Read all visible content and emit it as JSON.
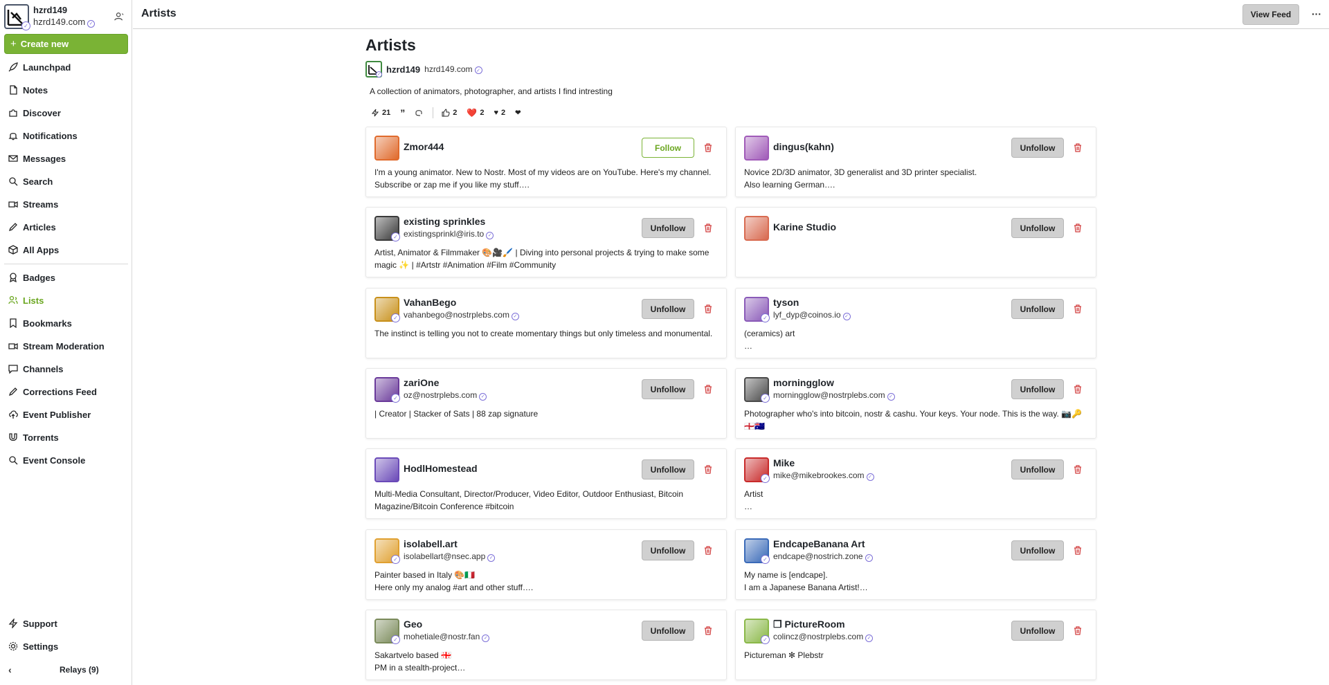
{
  "account": {
    "name": "hzrd149",
    "nip05": "hzrd149.com"
  },
  "sidebar": {
    "create_label": "Create new",
    "items": [
      {
        "label": "Launchpad",
        "icon": "rocket-icon"
      },
      {
        "label": "Notes",
        "icon": "note-icon"
      },
      {
        "label": "Discover",
        "icon": "puzzle-icon"
      },
      {
        "label": "Notifications",
        "icon": "bell-icon"
      },
      {
        "label": "Messages",
        "icon": "mail-icon"
      },
      {
        "label": "Search",
        "icon": "search-icon"
      },
      {
        "label": "Streams",
        "icon": "video-icon"
      },
      {
        "label": "Articles",
        "icon": "pen-icon"
      },
      {
        "label": "All Apps",
        "icon": "package-icon"
      },
      {
        "label": "Badges",
        "icon": "badge-icon"
      },
      {
        "label": "Lists",
        "icon": "users-icon"
      },
      {
        "label": "Bookmarks",
        "icon": "bookmark-icon"
      },
      {
        "label": "Stream Moderation",
        "icon": "video-icon"
      },
      {
        "label": "Channels",
        "icon": "message-icon"
      },
      {
        "label": "Corrections Feed",
        "icon": "pen-icon"
      },
      {
        "label": "Event Publisher",
        "icon": "upload-cloud-icon"
      },
      {
        "label": "Torrents",
        "icon": "magnet-icon"
      },
      {
        "label": "Event Console",
        "icon": "search-icon"
      },
      {
        "label": "Support",
        "icon": "lightning-icon"
      },
      {
        "label": "Settings",
        "icon": "gear-icon"
      }
    ],
    "active": "Lists",
    "relays_label": "Relays (9)"
  },
  "header": {
    "title": "Artists",
    "view_feed_label": "View Feed",
    "more_label": "···"
  },
  "list": {
    "title": "Artists",
    "author_name": "hzrd149",
    "author_nip05": "hzrd149.com",
    "description": "A collection of animators, photographer, and artists I find intresting",
    "reactions": {
      "zaps": "21",
      "likes": "2",
      "hearts": "2",
      "hearts2": "2"
    }
  },
  "colors": {
    "accent": "#7ab335",
    "delete": "#d13b3b",
    "verified": "#7c6fd8"
  },
  "people": [
    {
      "name": "Zmor444",
      "nip05": "",
      "about": "I'm a young animator. New to Nostr. Most of my videos are on YouTube. Here's my channel.\nSubscribe or zap me if you like my stuff….",
      "button": "Follow",
      "avatar_color": "#e06a2c",
      "verified": false
    },
    {
      "name": "dingus(kahn)",
      "nip05": "",
      "about": "Novice 2D/3D animator, 3D generalist and 3D printer specialist.\nAlso learning German….",
      "button": "Unfollow",
      "avatar_color": "#a05ab8",
      "verified": false
    },
    {
      "name": "existing sprinkles",
      "nip05": "existingsprinkl@iris.to",
      "about": "Artist, Animator & Filmmaker 🎨🎥🖌️ | Diving into personal projects & trying to make some\nmagic ✨ | #Artstr #Animation #Film #Community",
      "button": "Unfollow",
      "avatar_color": "#3a3a3a",
      "verified": true
    },
    {
      "name": "Karine Studio",
      "nip05": "",
      "about": "",
      "button": "Unfollow",
      "avatar_color": "#d86a50",
      "verified": false
    },
    {
      "name": "VahanBego",
      "nip05": "vahanbego@nostrplebs.com",
      "about": "The instinct is telling you not to create momentary things but only timeless and monumental.",
      "button": "Unfollow",
      "avatar_color": "#c8901a",
      "verified": true
    },
    {
      "name": "tyson",
      "nip05": "lyf_dyp@coinos.io",
      "about": "(ceramics) art\n…",
      "button": "Unfollow",
      "avatar_color": "#8a5ab8",
      "verified": true
    },
    {
      "name": "zariOne",
      "nip05": "oz@nostrplebs.com",
      "about": "| Creator | Stacker of Sats | 88 zap signature",
      "button": "Unfollow",
      "avatar_color": "#6a3a9a",
      "verified": true
    },
    {
      "name": "morningglow",
      "nip05": "morningglow@nostrplebs.com",
      "about": "Photographer who's into bitcoin, nostr & cashu. Your keys. Your node. This is the way. 📷🔑\n🏴󠁧󠁢󠁥󠁮󠁧󠁿🇦🇺",
      "button": "Unfollow",
      "avatar_color": "#4a4a4a",
      "verified": true
    },
    {
      "name": "HodlHomestead",
      "nip05": "",
      "about": "Multi-Media Consultant, Director/Producer, Video Editor, Outdoor Enthusiast, Bitcoin\nMagazine/Bitcoin Conference #bitcoin",
      "button": "Unfollow",
      "avatar_color": "#6a4ab8",
      "verified": false
    },
    {
      "name": "Mike",
      "nip05": "mike@mikebrookes.com",
      "about": "Artist\n…",
      "button": "Unfollow",
      "avatar_color": "#c82a2a",
      "verified": true
    },
    {
      "name": "isolabell.art",
      "nip05": "isolabellart@nsec.app",
      "about": "Painter based in Italy 🎨🇮🇹\nHere only my analog #art and other stuff….",
      "button": "Unfollow",
      "avatar_color": "#e0a030",
      "verified": true
    },
    {
      "name": "EndcapeBanana Art",
      "nip05": "endcape@nostrich.zone",
      "about": "My name is [endcape].\nI am a Japanese Banana Artist!…",
      "button": "Unfollow",
      "avatar_color": "#3a6ab8",
      "verified": true
    },
    {
      "name": "Geo",
      "nip05": "mohetiale@nostr.fan",
      "about": "Sakartvelo based 🇬🇪\nPM in a stealth-project…",
      "button": "Unfollow",
      "avatar_color": "#7a8a5a",
      "verified": true
    },
    {
      "name": "❐ PictureRoom",
      "nip05": "colincz@nostrplebs.com",
      "about": "Pictureman ✻ Plebstr",
      "button": "Unfollow",
      "avatar_color": "#8ab848",
      "verified": true
    }
  ]
}
